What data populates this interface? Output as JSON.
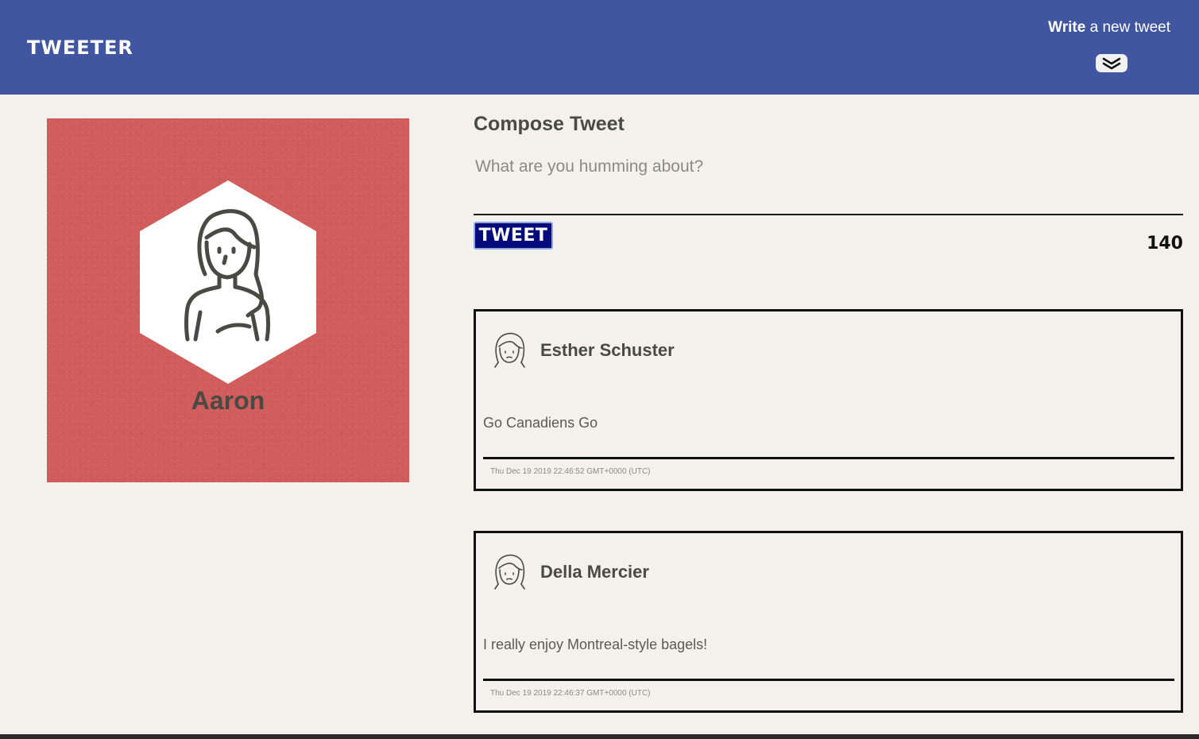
{
  "nav": {
    "brand": "TWEETER",
    "write_bold": "Write",
    "write_rest": " a new tweet",
    "toggle_icon": "double-chevron-down-icon"
  },
  "profile": {
    "name": "Aaron",
    "avatar_icon": "woman-avatar-icon",
    "background_color": "#d15c5c"
  },
  "compose": {
    "title": "Compose Tweet",
    "placeholder": "What are you humming about?",
    "value": "",
    "button_label": "TWEET",
    "counter": "140"
  },
  "tweets": [
    {
      "author": "Esther Schuster",
      "body": "Go Canadiens Go",
      "timestamp": "Thu Dec 19 2019 22:46:52 GMT+0000 (UTC)"
    },
    {
      "author": "Della Mercier",
      "body": "I really enjoy Montreal-style bagels!",
      "timestamp": "Thu Dec 19 2019 22:46:37 GMT+0000 (UTC)"
    }
  ],
  "colors": {
    "nav_bg": "#4056a1",
    "page_bg": "#f4f1ec",
    "button_bg": "#030a7a"
  }
}
